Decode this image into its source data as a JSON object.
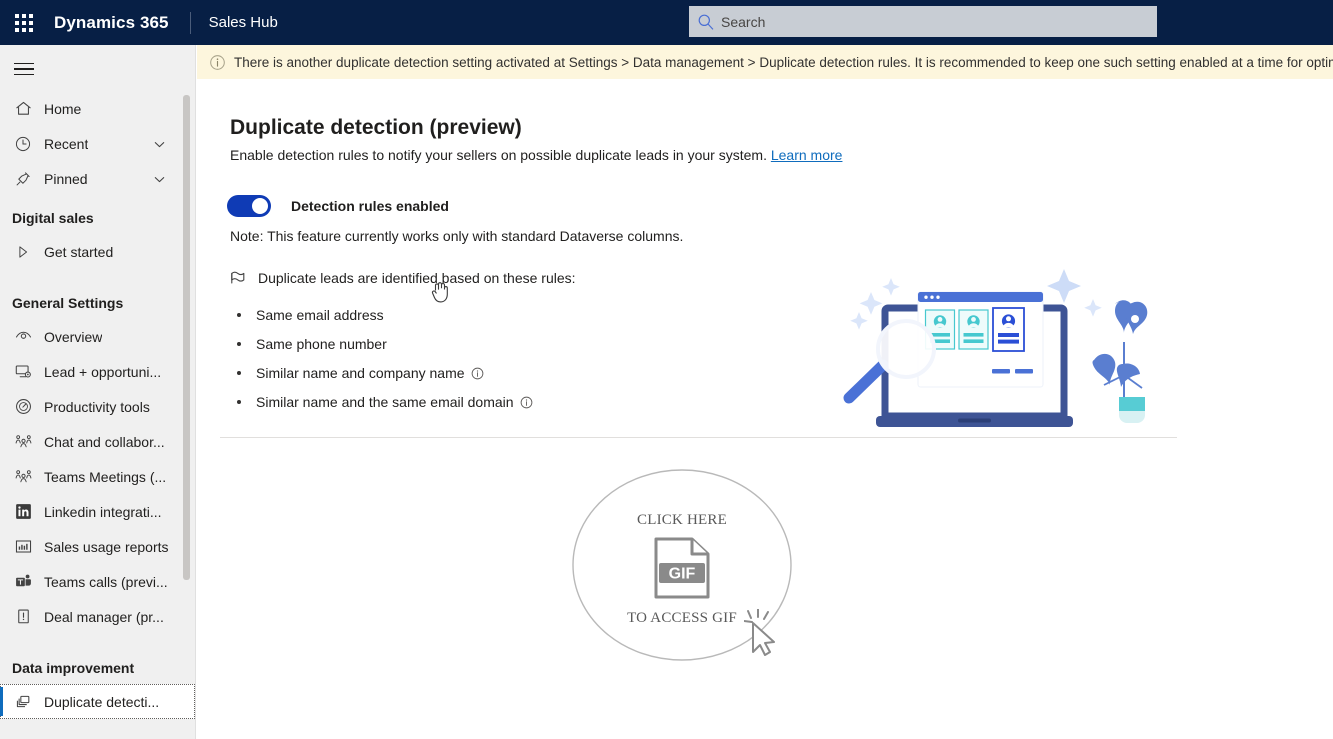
{
  "topbar": {
    "waffle_icon": "app-launcher-icon",
    "brand": "Dynamics 365",
    "app_title": "Sales Hub",
    "search": {
      "icon": "search-icon",
      "placeholder": "Search",
      "value": ""
    }
  },
  "notice": {
    "icon": "info-icon",
    "text": "There is another duplicate detection setting activated at Settings > Data management > Duplicate detection rules. It is recommended to keep one such setting enabled at a time for optimal user experience.",
    "background": "#fdf6dd"
  },
  "sidebar": {
    "hamburger_icon": "hamburger-menu-icon",
    "items": [
      {
        "label": "Home",
        "icon": "home-icon",
        "type": "item",
        "expandable": false,
        "selected": false
      },
      {
        "label": "Recent",
        "icon": "clock-icon",
        "type": "item",
        "expandable": true,
        "selected": false
      },
      {
        "label": "Pinned",
        "icon": "pin-icon",
        "type": "item",
        "expandable": true,
        "selected": false
      },
      {
        "label": "Digital sales",
        "type": "group"
      },
      {
        "label": "Get started",
        "icon": "play-triangle-icon",
        "type": "item",
        "expandable": false,
        "selected": false
      },
      {
        "label": "General Settings",
        "type": "group"
      },
      {
        "label": "Overview",
        "icon": "eye-icon",
        "type": "item",
        "expandable": false,
        "selected": false
      },
      {
        "label": "Lead + opportuni...",
        "icon": "lead-settings-icon",
        "type": "item",
        "expandable": false,
        "selected": false
      },
      {
        "label": "Productivity tools",
        "icon": "gauge-icon",
        "type": "item",
        "expandable": false,
        "selected": false
      },
      {
        "label": "Chat and collabor...",
        "icon": "people-icon",
        "type": "item",
        "expandable": false,
        "selected": false
      },
      {
        "label": "Teams Meetings (...",
        "icon": "people-icon",
        "type": "item",
        "expandable": false,
        "selected": false
      },
      {
        "label": "Linkedin integrati...",
        "icon": "linkedin-icon",
        "type": "item",
        "expandable": false,
        "selected": false
      },
      {
        "label": "Sales usage reports",
        "icon": "bar-chart-icon",
        "type": "item",
        "expandable": false,
        "selected": false
      },
      {
        "label": "Teams calls (previ...",
        "icon": "teams-icon",
        "type": "item",
        "expandable": false,
        "selected": false
      },
      {
        "label": "Deal manager (pr...",
        "icon": "alert-doc-icon",
        "type": "item",
        "expandable": false,
        "selected": false
      },
      {
        "label": "Data improvement",
        "type": "group"
      },
      {
        "label": "Duplicate detecti...",
        "icon": "duplicate-copies-icon",
        "type": "item",
        "expandable": false,
        "selected": true
      }
    ]
  },
  "main": {
    "title": "Duplicate detection (preview)",
    "subtitle": "Enable detection rules to notify your sellers on possible duplicate leads in your system.",
    "learn_more": "Learn more",
    "toggle": {
      "label": "Detection rules enabled",
      "enabled": true,
      "on_color": "#0f3bb5"
    },
    "note": "Note: This feature currently works only with standard Dataverse columns.",
    "rules_heading": "Duplicate leads are identified based on these rules:",
    "rules_heading_icon": "tag-icon",
    "rules": [
      {
        "label": "Same email address",
        "has_info": false
      },
      {
        "label": "Same phone number",
        "has_info": false
      },
      {
        "label": "Similar name and company name",
        "has_info": true
      },
      {
        "label": "Similar name and the same email domain",
        "has_info": true
      }
    ],
    "illustration_name": "duplicate-leads-illustration",
    "gif_card": {
      "top_text": "CLICK HERE",
      "icon_label": "GIF",
      "bottom_text": "TO ACCESS GIF"
    }
  },
  "colors": {
    "topbar_bg": "#071F45",
    "sidebar_bg": "#f0f0f0",
    "accent": "#0f6cbd",
    "notice_bg": "#fdf6dd",
    "content_bg": "#ffffff"
  }
}
